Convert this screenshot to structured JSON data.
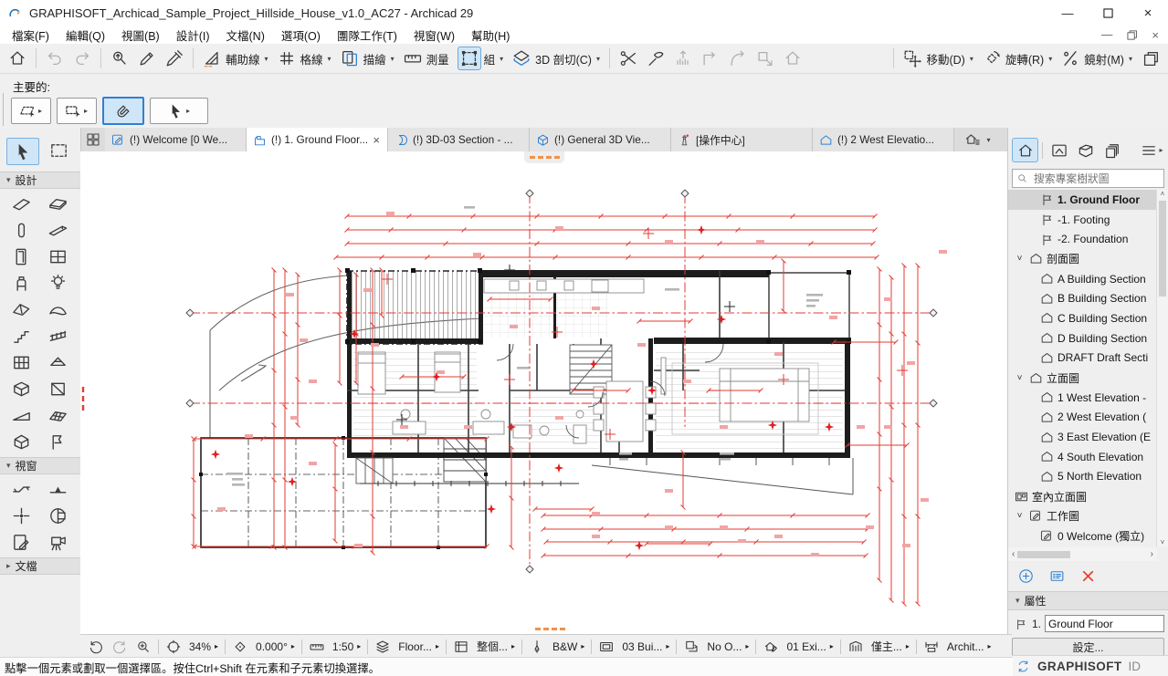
{
  "window": {
    "title": "GRAPHISOFT_Archicad_Sample_Project_Hillside_House_v1.0_AC27 - Archicad 29"
  },
  "menu": {
    "items": [
      "檔案(F)",
      "編輯(Q)",
      "視圖(B)",
      "設計(I)",
      "文檔(N)",
      "選項(O)",
      "團隊工作(T)",
      "視窗(W)",
      "幫助(H)"
    ]
  },
  "toolbar": {
    "layout": [
      {
        "items": [
          {
            "icon": "home"
          }
        ]
      },
      {
        "sep": true
      },
      {
        "items": [
          {
            "icon": "undo",
            "disabled": true
          },
          {
            "icon": "redo",
            "disabled": true
          }
        ]
      },
      {
        "sep": true
      },
      {
        "items": [
          {
            "icon": "find"
          },
          {
            "icon": "pickup"
          },
          {
            "icon": "inject"
          }
        ]
      },
      {
        "sep": true
      },
      {
        "items": [
          {
            "icon": "guide-lines",
            "label": "輔助線",
            "arrow": true
          },
          {
            "icon": "grid-snap",
            "label": "格線",
            "arrow": true
          },
          {
            "icon": "trace",
            "label": "描繪",
            "arrow": true
          },
          {
            "icon": "measure",
            "label": "測量"
          },
          {
            "icon": "group",
            "label": "組",
            "arrow": true,
            "active": true
          },
          {
            "icon": "3d-cutaway",
            "label": "3D 剖切(C)",
            "arrow": true
          }
        ]
      },
      {
        "sep": true
      },
      {
        "items": [
          {
            "icon": "split"
          },
          {
            "icon": "adjust"
          },
          {
            "icon": "elevate",
            "disabled": true
          },
          {
            "icon": "extend",
            "disabled": true
          },
          {
            "icon": "fillet",
            "disabled": true
          },
          {
            "icon": "resize",
            "disabled": true
          },
          {
            "icon": "home-outline",
            "disabled": true
          }
        ]
      },
      {
        "spacer": true
      },
      {
        "sep": true
      },
      {
        "items": [
          {
            "icon": "move",
            "label": "移動(D)",
            "arrow": true
          },
          {
            "icon": "rotate",
            "label": "旋轉(R)",
            "arrow": true
          },
          {
            "icon": "mirror",
            "label": "鏡射(M)",
            "arrow": true
          },
          {
            "icon": "dock"
          }
        ]
      }
    ]
  },
  "quick_bar": {
    "label": "主要的:",
    "buttons": [
      {
        "icon": "marquee-multi",
        "arrow": true
      },
      {
        "icon": "marquee-single",
        "arrow": true
      },
      {
        "icon": "magnet",
        "active": true
      },
      {
        "icon": "arrow",
        "arrow": true,
        "wide": true
      }
    ]
  },
  "tabs": [
    {
      "label": "(!) Welcome [0 We...",
      "icon": "tab-worksheet"
    },
    {
      "label": "(!) 1. Ground Floor...",
      "icon": "tab-story",
      "active": true,
      "closable": true
    },
    {
      "label": "(!) 3D-03 Section - ...",
      "icon": "tab-section"
    },
    {
      "label": "(!) General 3D Vie...",
      "icon": "tab-3d"
    },
    {
      "label": "[操作中心]",
      "icon": "tab-action",
      "dark": true
    },
    {
      "label": "(!) 2 West Elevatio...",
      "icon": "tab-elevation"
    }
  ],
  "toolbox": {
    "sections": [
      {
        "label": "設計",
        "state": "open",
        "tools": [
          "wall",
          "slab",
          "column",
          "beam",
          "door",
          "window",
          "objchair",
          "lamp",
          "roof",
          "shellx",
          "stair",
          "railing",
          "cwall",
          "skylight",
          "grid3d",
          "panel",
          "ramp",
          "meshx",
          "morph",
          "zone"
        ]
      },
      {
        "label": "視窗",
        "state": "open",
        "tools": [
          "sec-tool",
          "elev-tool",
          "int-elev",
          "sphere",
          "detail",
          "camera"
        ]
      },
      {
        "label": "文檔",
        "state": "collapsed",
        "tools": []
      }
    ]
  },
  "navigator": {
    "search_placeholder": "搜索專案樹狀圖",
    "tree": [
      {
        "label": "1. Ground Floor",
        "icon": "tree-story",
        "indent": 2,
        "selected": true
      },
      {
        "label": "-1. Footing",
        "icon": "tree-story",
        "indent": 2
      },
      {
        "label": "-2. Foundation",
        "icon": "tree-story",
        "indent": 2
      },
      {
        "label": "剖面圖",
        "icon": "tree-section",
        "indent": 1,
        "expandable": true
      },
      {
        "label": "A Building Section",
        "icon": "tree-section",
        "indent": 2
      },
      {
        "label": "B Building Section",
        "icon": "tree-section",
        "indent": 2
      },
      {
        "label": "C Building Section",
        "icon": "tree-section",
        "indent": 2
      },
      {
        "label": "D Building Section",
        "icon": "tree-section",
        "indent": 2
      },
      {
        "label": "DRAFT Draft Secti",
        "icon": "tree-section",
        "indent": 2
      },
      {
        "label": "立面圖",
        "icon": "tree-section",
        "indent": 1,
        "expandable": true
      },
      {
        "label": "1 West Elevation -",
        "icon": "tree-section",
        "indent": 2
      },
      {
        "label": "2 West Elevation (",
        "icon": "tree-section",
        "indent": 2
      },
      {
        "label": "3 East Elevation (E",
        "icon": "tree-section",
        "indent": 2
      },
      {
        "label": "4 South Elevation",
        "icon": "tree-section",
        "indent": 2
      },
      {
        "label": "5 North Elevation",
        "icon": "tree-section",
        "indent": 2
      },
      {
        "label": "室內立面圖",
        "icon": "tree-interior",
        "indent": 1
      },
      {
        "label": "工作圖",
        "icon": "tree-worksheet",
        "indent": 1,
        "expandable": true
      },
      {
        "label": "0 Welcome (獨立)",
        "icon": "tree-worksheet",
        "indent": 2
      }
    ],
    "properties": {
      "header": "屬性",
      "story_no": "1.",
      "story_name": "Ground Floor",
      "settings_label": "設定..."
    },
    "footer_brand": "GRAPHISOFT",
    "footer_id": "ID"
  },
  "status_bar": {
    "items": [
      {
        "icon": "undo-view"
      },
      {
        "icon": "redo-view",
        "disabled": true
      },
      {
        "icon": "zoom-in"
      },
      {
        "sep": true
      },
      {
        "icon": "fit-view"
      },
      {
        "label": "34%",
        "arrow": true
      },
      {
        "sep": true
      },
      {
        "icon": "rotate-view"
      },
      {
        "label": "0.000°",
        "arrow": true
      },
      {
        "sep": true
      },
      {
        "icon": "scale"
      },
      {
        "label": "1:50",
        "arrow": true
      },
      {
        "sep": true
      },
      {
        "icon": "layers"
      },
      {
        "label": "Floor...",
        "arrow": true
      },
      {
        "sep": true
      },
      {
        "icon": "pen-set"
      },
      {
        "label": "整個...",
        "arrow": true
      },
      {
        "sep": true
      },
      {
        "icon": "pen"
      },
      {
        "label": "B&W",
        "arrow": true
      },
      {
        "sep": true
      },
      {
        "icon": "model-view"
      },
      {
        "label": "03 Bui...",
        "arrow": true
      },
      {
        "sep": true
      },
      {
        "icon": "renovation"
      },
      {
        "label": "No O...",
        "arrow": true
      },
      {
        "sep": true
      },
      {
        "icon": "override"
      },
      {
        "label": "01 Exi...",
        "arrow": true
      },
      {
        "sep": true
      },
      {
        "icon": "partial-structure"
      },
      {
        "label": "僅主...",
        "arrow": true
      },
      {
        "sep": true
      },
      {
        "icon": "dimension"
      },
      {
        "label": "Archit...",
        "arrow": true
      }
    ]
  },
  "hint_bar": {
    "text": "點擊一個元素或劃取一個選擇區。按住Ctrl+Shift 在元素和子元素切換選擇。"
  },
  "colors": {
    "accent": "#2f80d0",
    "selection": "#cfe6f8",
    "drawing_red": "#e33b33",
    "trace_orange": "#f0924a",
    "alert_red": "#e8412f"
  }
}
